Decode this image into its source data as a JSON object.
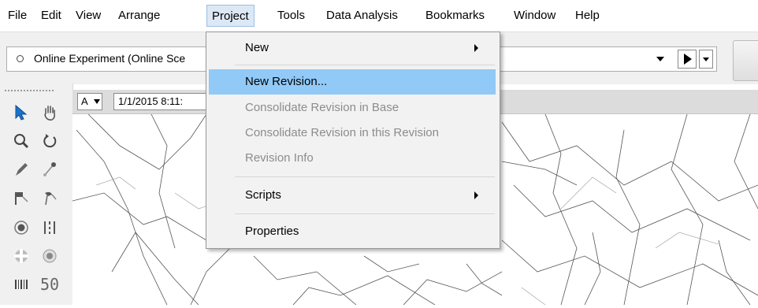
{
  "menubar": {
    "items": [
      "File",
      "Edit",
      "View",
      "Arrange",
      "Project",
      "Tools",
      "Data Analysis",
      "Bookmarks",
      "Window",
      "Help"
    ],
    "active": "Project"
  },
  "toolbar": {
    "experiment_combo": "Online Experiment (Online Sce"
  },
  "map_header": {
    "a_button": "A",
    "date_value": "1/1/2015 8:11:"
  },
  "palette": {
    "count_label": "50"
  },
  "project_menu": {
    "items": [
      {
        "label": "New",
        "disabled": false,
        "submenu": true
      },
      {
        "label": "New Revision...",
        "disabled": false,
        "highlighted": true
      },
      {
        "label": "Consolidate Revision in Base",
        "disabled": true
      },
      {
        "label": "Consolidate Revision in this Revision",
        "disabled": true
      },
      {
        "label": "Revision Info",
        "disabled": true
      },
      {
        "label": "Scripts",
        "disabled": false,
        "submenu": true
      },
      {
        "label": "Properties",
        "disabled": false
      }
    ]
  },
  "colors": {
    "highlight": "#91c9f7",
    "disabled_text": "#8c8c8c",
    "menu_bg": "#f2f2f2",
    "pointer_tool": "#1a73c9"
  }
}
